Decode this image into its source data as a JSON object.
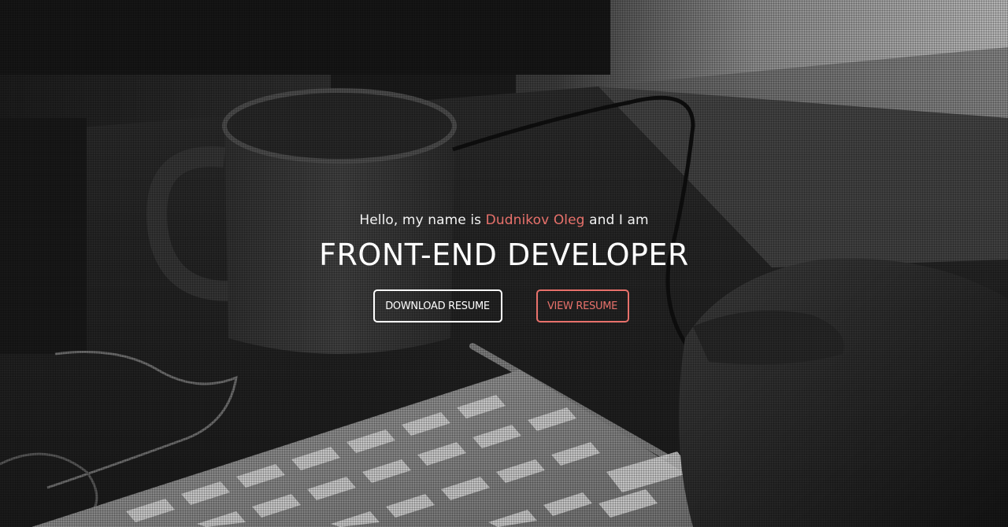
{
  "hero": {
    "greeting_prefix": "Hello, my name is ",
    "name": "Dudnikov Oleg",
    "greeting_suffix": " and I am",
    "title": "FRONT-END DEVELOPER",
    "download_label": "DOWNLOAD RESUME",
    "view_label": "VIEW RESUME"
  },
  "colors": {
    "accent": "#e8716b",
    "text": "#ffffff"
  }
}
